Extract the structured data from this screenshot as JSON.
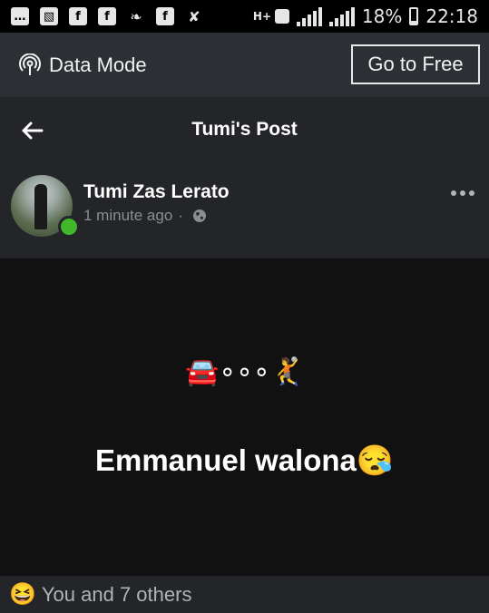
{
  "status_bar": {
    "left_icons": [
      {
        "name": "message-icon",
        "glyph": "…"
      },
      {
        "name": "gallery-icon",
        "glyph": "▧"
      },
      {
        "name": "facebook-icon",
        "glyph": "f"
      },
      {
        "name": "facebook-icon",
        "glyph": "f"
      },
      {
        "name": "twitter-icon",
        "glyph": "❧"
      },
      {
        "name": "facebook-icon",
        "glyph": "f"
      },
      {
        "name": "mute-icon",
        "glyph": "✘"
      }
    ],
    "network": "H+",
    "battery": "18%",
    "battery_level": 0.18,
    "time": "22:18"
  },
  "data_mode_bar": {
    "label": "Data Mode",
    "icon": "broadcast-icon",
    "button": "Go to Free"
  },
  "header": {
    "back_icon": "back-arrow-icon",
    "title": "Tumi's Post"
  },
  "post": {
    "author": "Tumi Zas Lerato",
    "online": true,
    "time": "1 minute ago",
    "separator": "·",
    "privacy_icon": "globe-icon",
    "more_icon": "more-options-icon",
    "emoji_line": "🚘∘∘∘🤾",
    "text": "Emmanuel walona😪"
  },
  "reactions": {
    "emoji": "😆",
    "text": "You and 7 others"
  },
  "colors": {
    "background": "#111111",
    "card": "#232528",
    "data_bar": "#2c2f33",
    "online": "#42b72a",
    "secondary_text": "#8a8d91"
  }
}
